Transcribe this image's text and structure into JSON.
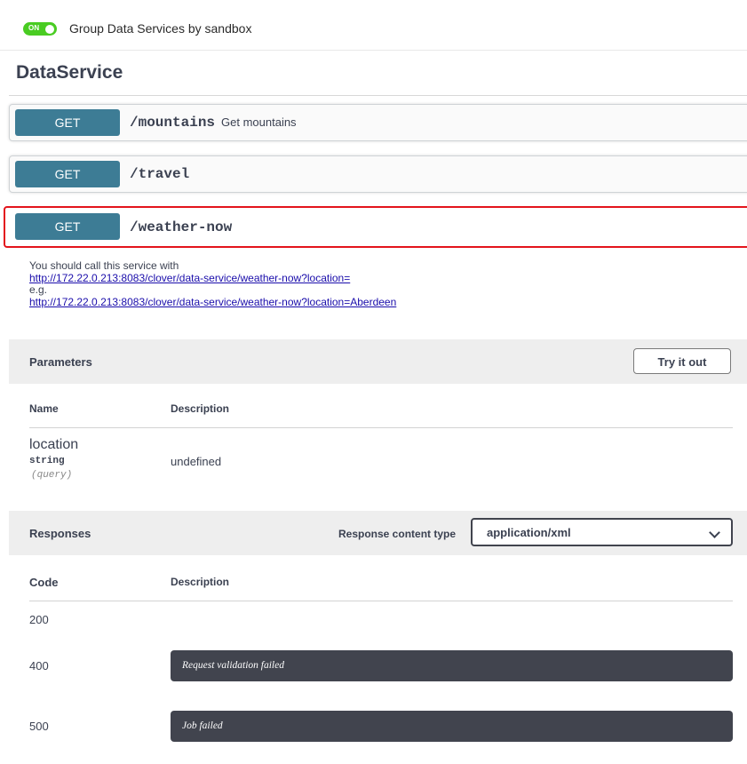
{
  "topbar": {
    "toggle_text": "ON",
    "toggle_label": "Group Data Services by sandbox"
  },
  "section": {
    "title": "DataService"
  },
  "operations": [
    {
      "method": "GET",
      "path": "/mountains",
      "summary": "Get mountains"
    },
    {
      "method": "GET",
      "path": "/travel",
      "summary": ""
    },
    {
      "method": "GET",
      "path": "/weather-now",
      "summary": ""
    }
  ],
  "description": {
    "intro": "You should call this service with",
    "link1": "http://172.22.0.213:8083/clover/data-service/weather-now?location=",
    "eg": "e.g.",
    "link2": "http://172.22.0.213:8083/clover/data-service/weather-now?location=Aberdeen"
  },
  "parameters": {
    "title": "Parameters",
    "try_label": "Try it out",
    "col_name": "Name",
    "col_desc": "Description",
    "rows": [
      {
        "name": "location",
        "type": "string",
        "in": "(query)",
        "description": "undefined"
      }
    ]
  },
  "responses": {
    "title": "Responses",
    "content_type_label": "Response content type",
    "content_type_value": "application/xml",
    "col_code": "Code",
    "col_desc": "Description",
    "rows": [
      {
        "code": "200",
        "description": ""
      },
      {
        "code": "400",
        "description": "Request validation failed"
      },
      {
        "code": "500",
        "description": "Job failed"
      }
    ]
  },
  "colors": {
    "get_method": "#3d7c95",
    "toggle_on": "#49cc22",
    "highlight": "#e3141c",
    "response_box": "#41444e"
  }
}
